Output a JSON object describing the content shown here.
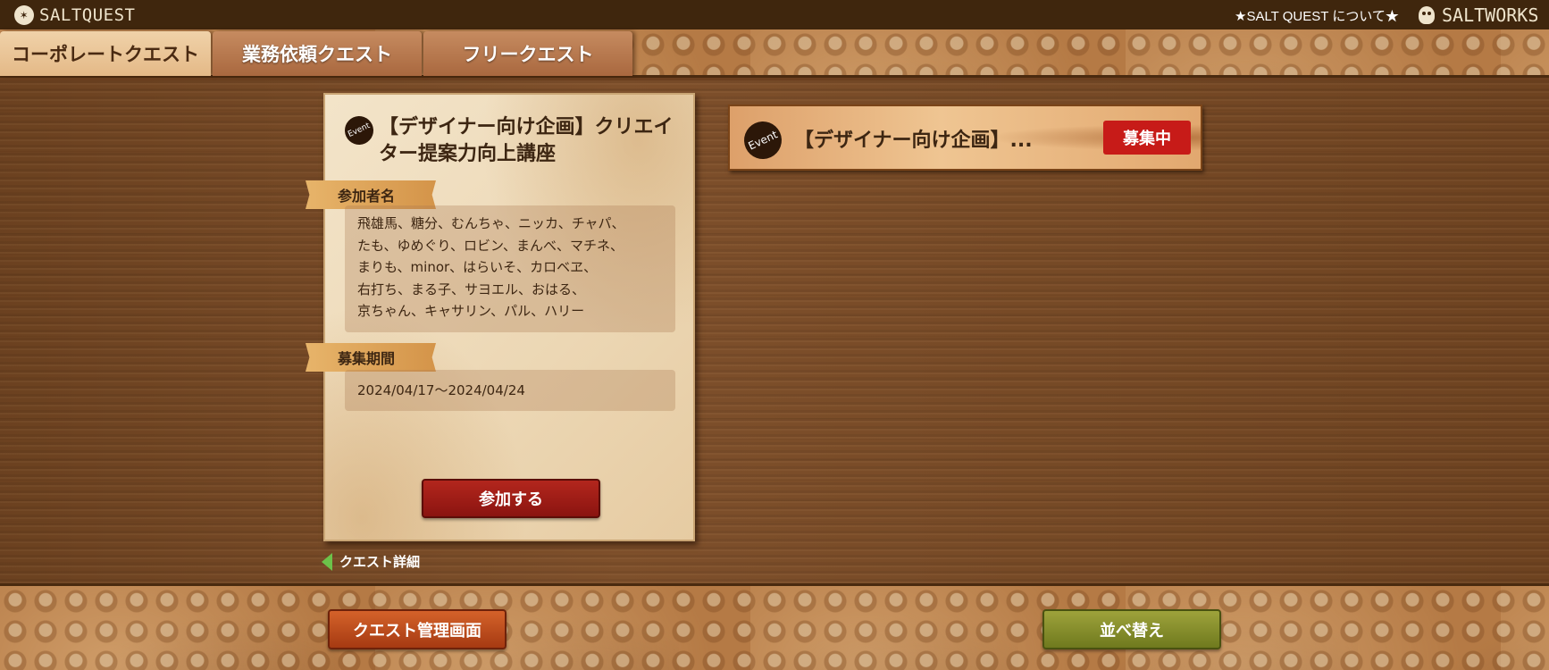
{
  "header": {
    "brand": "SALTQUEST",
    "about_link": "★SALT QUEST について★",
    "works": "SALTWORKS"
  },
  "tabs": [
    {
      "label": "コーポレートクエスト",
      "active": true
    },
    {
      "label": "業務依頼クエスト",
      "active": false
    },
    {
      "label": "フリークエスト",
      "active": false
    }
  ],
  "detail": {
    "badge": "Event",
    "title": "【デザイナー向け企画】クリエイター提案力向上講座",
    "participants_label": "参加者名",
    "participants": [
      "飛雄馬、糖分、むんちゃ、ニッカ、チャパ、",
      "たも、ゆめぐり、ロビン、まんべ、マチネ、",
      "まりも、minor、はらいそ、カロベヱ、",
      "右打ち、まる子、サヨエル、おはる、",
      "京ちゃん、キャサリン、パル、ハリー"
    ],
    "period_label": "募集期間",
    "period": "2024/04/17〜2024/04/24",
    "join_button": "参加する"
  },
  "detail_link": "クエスト詳細",
  "list": [
    {
      "badge": "Event",
      "title": "【デザイナー向け企画】...",
      "status": "募集中"
    }
  ],
  "footer": {
    "manage_button": "クエスト管理画面",
    "sort_button": "並べ替え"
  },
  "colors": {
    "topbar": "#3f260d",
    "status_red": "#c71b18",
    "join_red": "#a11d17",
    "manage_orange": "#c4501f",
    "sort_olive": "#868e2b",
    "link_arrow": "#6cc24a"
  }
}
